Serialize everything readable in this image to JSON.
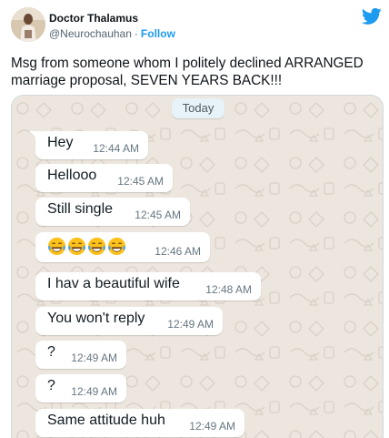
{
  "author": {
    "name": "Doctor Thalamus",
    "handle": "@Neurochauhan",
    "separator": "·",
    "follow_label": "Follow"
  },
  "tweet": {
    "text": "Msg from someone whom I politely declined ARRANGED marriage proposal, SEVEN YEARS BACK!!!"
  },
  "chat": {
    "date_label": "Today",
    "messages": [
      {
        "text": "Hey",
        "time": "12:44 AM"
      },
      {
        "text": "Hellooo",
        "time": "12:45 AM"
      },
      {
        "text": "Still single",
        "time": "12:45 AM"
      },
      {
        "text": "",
        "emoji": [
          "tears-of-joy-emoji",
          "tears-of-joy-emoji",
          "tears-of-joy-emoji",
          "tears-of-joy-emoji"
        ],
        "time": "12:46 AM"
      },
      {
        "text": "I hav a beautiful wife",
        "time": "12:48 AM"
      },
      {
        "text": "You won't reply",
        "time": "12:49 AM"
      },
      {
        "text": "?",
        "time": "12:49 AM"
      },
      {
        "text": "?",
        "time": "12:49 AM"
      },
      {
        "text": "Same attitude huh",
        "time": "12:49 AM"
      }
    ]
  },
  "colors": {
    "twitter_blue": "#1d9bf0",
    "chat_background": "#ece6de",
    "bubble": "#ffffff",
    "timestamp": "#667781"
  },
  "icons": [
    "twitter-bird-icon",
    "avatar",
    "tears-of-joy-emoji"
  ]
}
